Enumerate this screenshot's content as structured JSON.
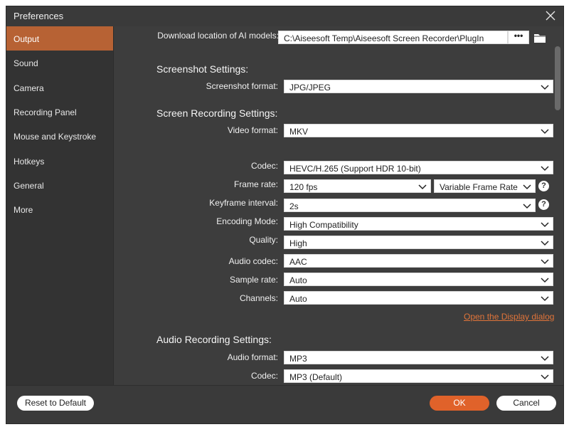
{
  "window": {
    "title": "Preferences"
  },
  "sidebar": {
    "items": [
      {
        "label": "Output"
      },
      {
        "label": "Sound"
      },
      {
        "label": "Camera"
      },
      {
        "label": "Recording Panel"
      },
      {
        "label": "Mouse and Keystroke"
      },
      {
        "label": "Hotkeys"
      },
      {
        "label": "General"
      },
      {
        "label": "More"
      }
    ],
    "active_index": 0
  },
  "output": {
    "download_label": "Download location of AI models:",
    "download_path": "C:\\Aiseesoft Temp\\Aiseesoft Screen Recorder\\PlugIn",
    "browse_label": "•••",
    "screenshot_section": "Screenshot Settings:",
    "screenshot_format_label": "Screenshot format:",
    "screenshot_format": "JPG/JPEG",
    "screen_section": "Screen Recording Settings:",
    "video_format_label": "Video format:",
    "video_format": "MKV",
    "codec_label": "Codec:",
    "codec": "HEVC/H.265 (Support HDR 10-bit)",
    "frame_rate_label": "Frame rate:",
    "frame_rate": "120 fps",
    "frame_rate_mode": "Variable Frame Rate",
    "keyframe_label": "Keyframe interval:",
    "keyframe": "2s",
    "encoding_label": "Encoding Mode:",
    "encoding": "High Compatibility",
    "quality_label": "Quality:",
    "quality": "High",
    "audio_codec_label": "Audio codec:",
    "audio_codec": "AAC",
    "sample_rate_label": "Sample rate:",
    "sample_rate": "Auto",
    "channels_label": "Channels:",
    "channels": "Auto",
    "display_link": "Open the Display dialog",
    "audio_section": "Audio Recording Settings:",
    "audio_format_label": "Audio format:",
    "audio_format": "MP3",
    "audio_rec_codec_label": "Codec:",
    "audio_rec_codec": "MP3 (Default)",
    "help_label": "?"
  },
  "footer": {
    "reset_label": "Reset to Default",
    "ok_label": "OK",
    "cancel_label": "Cancel"
  },
  "colors": {
    "accent": "#e0622a",
    "sidebar_active": "#b76234",
    "panel_bg": "#3d3d3d",
    "sidebar_bg": "#333333",
    "link": "#e0743a"
  }
}
